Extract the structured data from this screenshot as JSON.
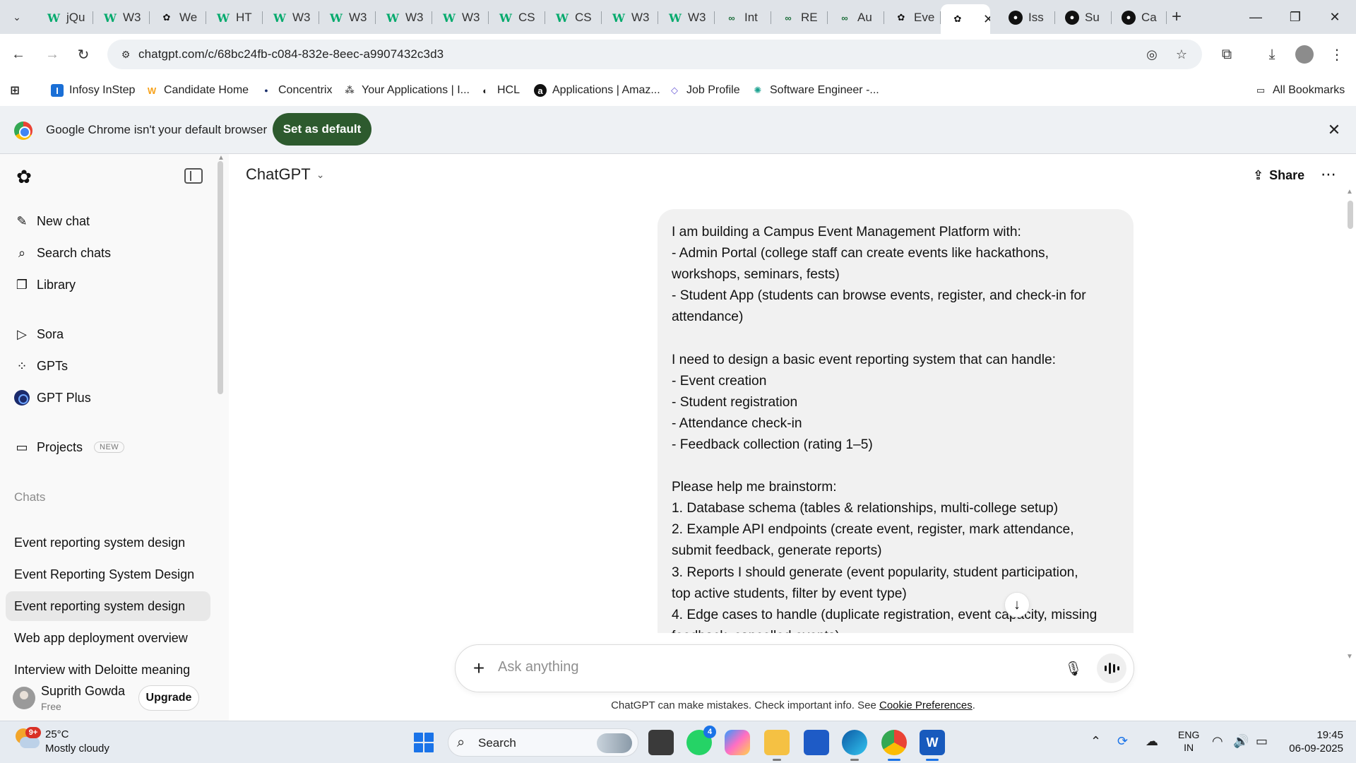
{
  "browser": {
    "tabs": [
      {
        "label": "jQu",
        "icon": "w3schools-icon",
        "active": false
      },
      {
        "label": "W3",
        "icon": "w3schools-icon",
        "active": false
      },
      {
        "label": "We",
        "icon": "chatgpt-icon",
        "active": false
      },
      {
        "label": "HT",
        "icon": "w3schools-icon",
        "active": false
      },
      {
        "label": "W3",
        "icon": "w3schools-icon",
        "active": false
      },
      {
        "label": "W3",
        "icon": "w3schools-icon",
        "active": false
      },
      {
        "label": "W3",
        "icon": "w3schools-icon",
        "active": false
      },
      {
        "label": "W3",
        "icon": "w3schools-icon",
        "active": false
      },
      {
        "label": "CS",
        "icon": "w3schools-icon",
        "active": false
      },
      {
        "label": "CS",
        "icon": "w3schools-icon",
        "active": false
      },
      {
        "label": "W3",
        "icon": "w3schools-icon",
        "active": false
      },
      {
        "label": "W3",
        "icon": "w3schools-icon",
        "active": false
      },
      {
        "label": "Int",
        "icon": "link-icon",
        "active": false
      },
      {
        "label": "RE",
        "icon": "link-icon",
        "active": false
      },
      {
        "label": "Au",
        "icon": "link-icon",
        "active": false
      },
      {
        "label": "Eve",
        "icon": "chatgpt-icon",
        "active": false
      },
      {
        "label": "",
        "icon": "chatgpt-icon",
        "active": true
      },
      {
        "label": "Iss",
        "icon": "github-icon",
        "active": false
      },
      {
        "label": "Su",
        "icon": "github-icon",
        "active": false
      },
      {
        "label": "Ca",
        "icon": "github-icon",
        "active": false
      }
    ],
    "url": "chatgpt.com/c/68bc24fb-c084-832e-8eec-a9907432c3d3",
    "bookmarks": [
      {
        "label": "Infosy InStep",
        "icon": "infosys-icon"
      },
      {
        "label": "Candidate Home",
        "icon": "workday-icon"
      },
      {
        "label": "Concentrix",
        "icon": "concentrix-icon"
      },
      {
        "label": "Your Applications | I...",
        "icon": "applications-icon"
      },
      {
        "label": "HCL",
        "icon": "hcl-icon"
      },
      {
        "label": "Applications | Amaz...",
        "icon": "amazon-icon"
      },
      {
        "label": "Job Profile",
        "icon": "job-profile-icon"
      },
      {
        "label": "Software Engineer -...",
        "icon": "gear-icon"
      }
    ],
    "all_bookmarks": "All Bookmarks",
    "infobar": {
      "message": "Google Chrome isn't your default browser",
      "button": "Set as default"
    }
  },
  "sidebar": {
    "top_items": [
      {
        "label": "New chat",
        "icon": "new-chat-icon"
      },
      {
        "label": "Search chats",
        "icon": "search-icon"
      },
      {
        "label": "Library",
        "icon": "library-icon"
      }
    ],
    "apps": [
      {
        "label": "Sora",
        "icon": "sora-icon"
      },
      {
        "label": "GPTs",
        "icon": "gpts-icon"
      },
      {
        "label": "GPT Plus",
        "icon": "gpt-plus-icon"
      }
    ],
    "projects": {
      "label": "Projects",
      "badge": "NEW"
    },
    "chats_heading": "Chats",
    "chats": [
      {
        "label": "Event reporting system design",
        "active": false
      },
      {
        "label": "Event Reporting System Design",
        "active": false
      },
      {
        "label": "Event reporting system design",
        "active": true
      },
      {
        "label": "Web app deployment overview",
        "active": false
      },
      {
        "label": "Interview with Deloitte meaning",
        "active": false
      }
    ],
    "user": {
      "name": "Suprith Gowda",
      "plan": "Free",
      "upgrade": "Upgrade"
    }
  },
  "main": {
    "model": "ChatGPT",
    "share": "Share",
    "message_lines": [
      "I am building a Campus Event Management Platform with:",
      "- Admin Portal (college staff can create events like hackathons,",
      "workshops, seminars, fests)",
      "- Student App (students can browse events, register, and check-in for",
      "attendance)",
      "",
      "I need to design a basic event reporting system that can handle:",
      "- Event creation",
      "- Student registration",
      "- Attendance check-in",
      "- Feedback collection (rating 1–5)",
      "",
      "Please help me brainstorm:",
      "1. Database schema (tables & relationships, multi-college setup)",
      "2. Example API endpoints (create event, register, mark attendance,",
      "submit feedback, generate reports)",
      "3. Reports I should generate (event popularity, student participation,",
      "top active students, filter by event type)",
      "4. Edge cases to handle (duplicate registration, event capacity, missing",
      "feedback, cancelled events)"
    ],
    "composer_placeholder": "Ask anything",
    "disclaimer": "ChatGPT can make mistakes. Check important info. See",
    "disclaimer_link": "Cookie Preferences",
    "disclaimer_end": "."
  },
  "taskbar": {
    "weather": {
      "temp": "25°C",
      "condition": "Mostly cloudy",
      "badge": "9+"
    },
    "search_label": "Search",
    "apps": [
      {
        "name": "task-view",
        "label": ""
      },
      {
        "name": "whatsapp",
        "label": "",
        "count": "4"
      },
      {
        "name": "copilot",
        "label": ""
      },
      {
        "name": "file-explorer",
        "label": ""
      },
      {
        "name": "microsoft-store",
        "label": ""
      },
      {
        "name": "edge",
        "label": ""
      },
      {
        "name": "chrome",
        "label": ""
      },
      {
        "name": "word",
        "label": "W"
      }
    ],
    "language": {
      "line1": "ENG",
      "line2": "IN"
    },
    "clock": {
      "time": "19:45",
      "date": "06-09-2025"
    }
  }
}
